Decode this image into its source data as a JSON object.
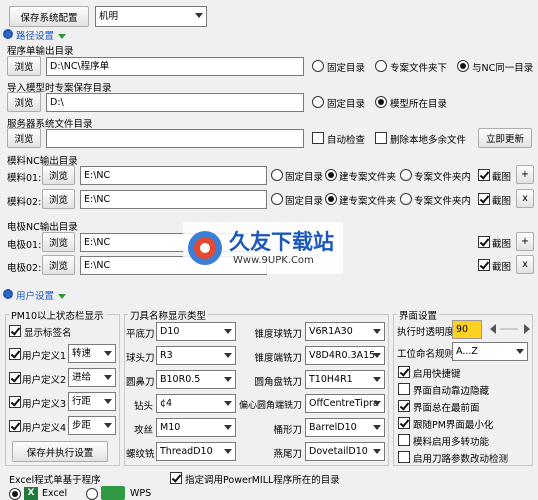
{
  "top": {
    "save_config": "保存系统配置",
    "machine": "机明"
  },
  "path_settings": {
    "header": "路径设置",
    "program_output": {
      "label": "程序单输出目录",
      "browse": "浏览",
      "value": "D:\\NC\\程序单",
      "options": [
        "固定目录",
        "专案文件夹下",
        "与NC同一目录"
      ],
      "selected": 2
    },
    "model_save": {
      "label": "导入模型时专案保存目录",
      "browse": "浏览",
      "value": "D:\\",
      "options": [
        "固定目录",
        "模型所在目录"
      ],
      "selected": 1
    },
    "server_files": {
      "label": "服务器系统文件目录",
      "browse": "浏览",
      "value": "",
      "auto_check": "自动检查",
      "delete_local": "删除本地多余文件",
      "update_now": "立即更新"
    },
    "mold_nc": {
      "label": "模料NC输出目录",
      "rows": [
        {
          "name": "模料01:",
          "browse": "浏览",
          "value": "E:\\NC",
          "sign": "+"
        },
        {
          "name": "模料02:",
          "browse": "浏览",
          "value": "E:\\NC",
          "sign": "x"
        }
      ],
      "options": [
        "固定目录",
        "建专案文件夹",
        "专案文件夹内"
      ],
      "selected": 1,
      "snapshot": "截图"
    },
    "electrode_nc": {
      "label": "电极NC输出目录",
      "rows": [
        {
          "name": "电极01:",
          "browse": "浏览",
          "value": "E:\\NC",
          "sign": "+"
        },
        {
          "name": "电极02:",
          "browse": "浏览",
          "value": "E:\\NC",
          "sign": "x"
        }
      ],
      "snapshot": "截图"
    }
  },
  "watermark": {
    "title": "久友下载站",
    "url": "Www.9UPK.Com"
  },
  "user_settings": {
    "header": "用户设置",
    "statusbar": {
      "title": "PM10以上状态栏显示",
      "show_tag": "显示标签名",
      "items": [
        {
          "label": "用户定义1",
          "value": "转速"
        },
        {
          "label": "用户定义2",
          "value": "进给"
        },
        {
          "label": "用户定义3",
          "value": "行距"
        },
        {
          "label": "用户定义4",
          "value": "步距"
        }
      ],
      "save_run": "保存并执行设置"
    },
    "tools": {
      "title": "刀具名称显示类型",
      "left": [
        {
          "label": "平底刀",
          "value": "D10"
        },
        {
          "label": "球头刀",
          "value": "R3"
        },
        {
          "label": "圆鼻刀",
          "value": "B10R0.5"
        },
        {
          "label": "钻头",
          "value": "¢4"
        },
        {
          "label": "攻丝",
          "value": "M10"
        },
        {
          "label": "螺纹铣",
          "value": "ThreadD10"
        }
      ],
      "right": [
        {
          "label": "锥度球铣刀",
          "value": "V6R1A30"
        },
        {
          "label": "锥度端铣刀",
          "value": "V8D4R0.3A15"
        },
        {
          "label": "圆角盘铣刀",
          "value": "T10H4R1"
        },
        {
          "label": "偏心圆角端铣刀",
          "value": "OffCentreTipra"
        },
        {
          "label": "桶形刀",
          "value": "BarrelD10"
        },
        {
          "label": "燕尾刀",
          "value": "DovetailD10"
        }
      ]
    },
    "interface": {
      "title": "界面设置",
      "opacity_label": "执行时透明度",
      "opacity_value": "90",
      "naming_label": "工位命名规则",
      "naming_value": "A...Z",
      "options": [
        {
          "label": "启用快捷键",
          "checked": true
        },
        {
          "label": "界面自动靠边隐藏",
          "checked": false
        },
        {
          "label": "界面总在最前面",
          "checked": true
        },
        {
          "label": "跟随PM界面最小化",
          "checked": true
        },
        {
          "label": "模料启用多转功能",
          "checked": false
        },
        {
          "label": "启用刀路参数改动检测",
          "checked": false
        }
      ]
    },
    "excel": {
      "title": "Excel程式单基于程序",
      "excel": "Excel",
      "wps": "WPS"
    },
    "pm_dir": "指定调用PowerMILL程序所在的目录"
  }
}
